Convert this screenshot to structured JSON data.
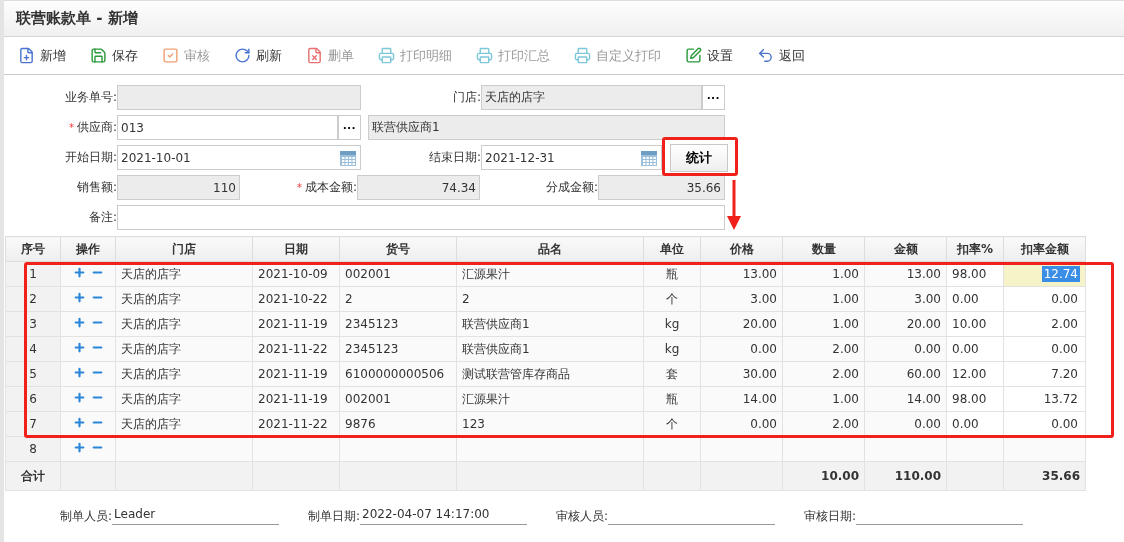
{
  "window": {
    "title": "联营账款单 - 新增"
  },
  "toolbar": [
    {
      "kind": "new",
      "label": "新增",
      "disabled": false
    },
    {
      "kind": "save",
      "label": "保存",
      "disabled": false
    },
    {
      "kind": "audit",
      "label": "审核",
      "disabled": true
    },
    {
      "kind": "refresh",
      "label": "刷新",
      "disabled": false
    },
    {
      "kind": "delete",
      "label": "删单",
      "disabled": true
    },
    {
      "kind": "print",
      "label": "打印明细",
      "disabled": true
    },
    {
      "kind": "print",
      "label": "打印汇总",
      "disabled": true
    },
    {
      "kind": "print",
      "label": "自定义打印",
      "disabled": true
    },
    {
      "kind": "settings",
      "label": "设置",
      "disabled": false
    },
    {
      "kind": "back",
      "label": "返回",
      "disabled": false
    }
  ],
  "form": {
    "required_mark": "*",
    "order_no": {
      "label": "业务单号:",
      "readonly": true,
      "required": false
    },
    "store": {
      "label": "门店:",
      "value": "天店的店字",
      "readonly": true,
      "required": false,
      "more_button": "···"
    },
    "supplier": {
      "label": "供应商:",
      "value": "013",
      "readonly": false,
      "required": true,
      "more_button": "···"
    },
    "supplier_name": {
      "value": "联营供应商1",
      "readonly": true
    },
    "start_date": {
      "label": "开始日期:",
      "value": "2021-10-01",
      "readonly": false,
      "required": false
    },
    "end_date": {
      "label": "结束日期:",
      "value": "2021-12-31",
      "readonly": false,
      "required": false
    },
    "stat_button": {
      "label": "统计"
    },
    "sales": {
      "label": "销售额:",
      "value": "110",
      "readonly": true,
      "required": false
    },
    "cost": {
      "label": "成本金额:",
      "value": "74.34",
      "readonly": true,
      "required": true
    },
    "share": {
      "label": "分成金额:",
      "value": "35.66",
      "readonly": true,
      "required": false
    },
    "remark": {
      "label": "备注:",
      "readonly": false,
      "required": false
    }
  },
  "table": {
    "columns": [
      "序号",
      "操作",
      "门店",
      "日期",
      "货号",
      "品名",
      "单位",
      "价格",
      "数量",
      "金额",
      "扣率%",
      "扣率金额"
    ],
    "rows": [
      {
        "no": "1",
        "store": "天店的店字",
        "date": "2021-10-09",
        "code": "002001",
        "name": "汇源果汁",
        "unit": "瓶",
        "price": "13.00",
        "qty": "1.00",
        "amount": "13.00",
        "rate": "98.00",
        "rate_amount": "12.74",
        "editing": true
      },
      {
        "no": "2",
        "store": "天店的店字",
        "date": "2021-10-22",
        "code": "2",
        "name": "2",
        "unit": "个",
        "price": "3.00",
        "qty": "1.00",
        "amount": "3.00",
        "rate": "0.00",
        "rate_amount": "0.00",
        "editing": false
      },
      {
        "no": "3",
        "store": "天店的店字",
        "date": "2021-11-19",
        "code": "2345123",
        "name": "联营供应商1",
        "unit": "kg",
        "price": "20.00",
        "qty": "1.00",
        "amount": "20.00",
        "rate": "10.00",
        "rate_amount": "2.00",
        "editing": false
      },
      {
        "no": "4",
        "store": "天店的店字",
        "date": "2021-11-22",
        "code": "2345123",
        "name": "联营供应商1",
        "unit": "kg",
        "price": "0.00",
        "qty": "2.00",
        "amount": "0.00",
        "rate": "0.00",
        "rate_amount": "0.00",
        "editing": false
      },
      {
        "no": "5",
        "store": "天店的店字",
        "date": "2021-11-19",
        "code": "6100000000506",
        "name": "测试联营管库存商品",
        "unit": "套",
        "price": "30.00",
        "qty": "2.00",
        "amount": "60.00",
        "rate": "12.00",
        "rate_amount": "7.20",
        "editing": false
      },
      {
        "no": "6",
        "store": "天店的店字",
        "date": "2021-11-19",
        "code": "002001",
        "name": "汇源果汁",
        "unit": "瓶",
        "price": "14.00",
        "qty": "1.00",
        "amount": "14.00",
        "rate": "98.00",
        "rate_amount": "13.72",
        "editing": false
      },
      {
        "no": "7",
        "store": "天店的店字",
        "date": "2021-11-22",
        "code": "9876",
        "name": "123",
        "unit": "个",
        "price": "0.00",
        "qty": "2.00",
        "amount": "0.00",
        "rate": "0.00",
        "rate_amount": "0.00",
        "editing": false
      },
      {
        "no": "8"
      }
    ],
    "total": {
      "label": "合计",
      "qty": "10.00",
      "amount": "110.00",
      "rate_amount": "35.66"
    }
  },
  "footer": [
    {
      "label": "制单人员:",
      "value": "Leader"
    },
    {
      "label": "制单日期:",
      "value": "2022-04-07 14:17:00"
    },
    {
      "label": "审核人员:"
    },
    {
      "label": "审核日期:"
    }
  ]
}
